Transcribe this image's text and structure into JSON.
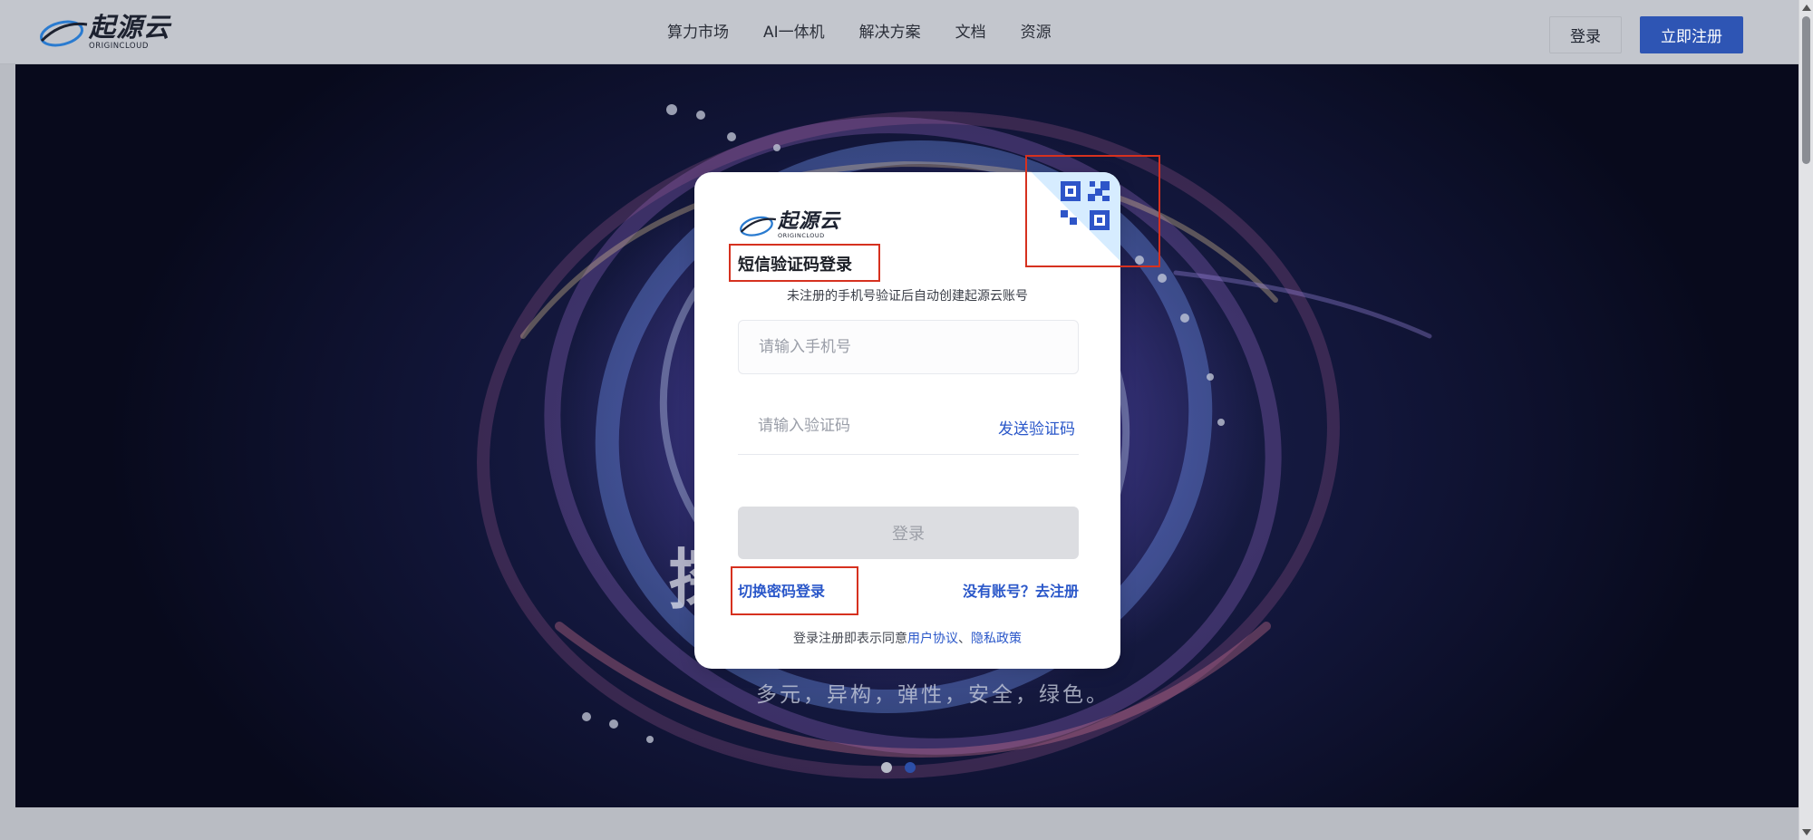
{
  "navbar": {
    "logo": {
      "brand": "起源云",
      "sub": "ORIGINCLOUD"
    },
    "menu": [
      {
        "label": "算力市场"
      },
      {
        "label": "AI一体机"
      },
      {
        "label": "解决方案"
      },
      {
        "label": "文档"
      },
      {
        "label": "资源"
      }
    ],
    "login_label": "登录",
    "register_label": "立即注册"
  },
  "hero": {
    "title": "探",
    "subtitle": "多元，异构，弹性，安全，绿色。",
    "carousel_total": 2,
    "carousel_active": 2
  },
  "modal": {
    "logo": {
      "brand": "起源云",
      "sub": "ORIGINCLOUD"
    },
    "title": "短信验证码登录",
    "hint": "未注册的手机号验证后自动创建起源云账号",
    "phone_placeholder": "请输入手机号",
    "code_placeholder": "请输入验证码",
    "send_code_label": "发送验证码",
    "login_label": "登录",
    "switch_label": "切换密码登录",
    "register_label": "没有账号？去注册",
    "agreement": {
      "prefix": "登录注册即表示同意",
      "user_agreement": "用户协议",
      "separator": "、",
      "privacy_policy": "隐私政策"
    }
  },
  "colors": {
    "accent": "#2e55b4",
    "link": "#2a57c9",
    "annotation": "#d6311f",
    "disabled_button": "#dcdde1"
  },
  "icons": {
    "logo": "swoosh-logo-icon",
    "qr": "qr-code-icon"
  }
}
